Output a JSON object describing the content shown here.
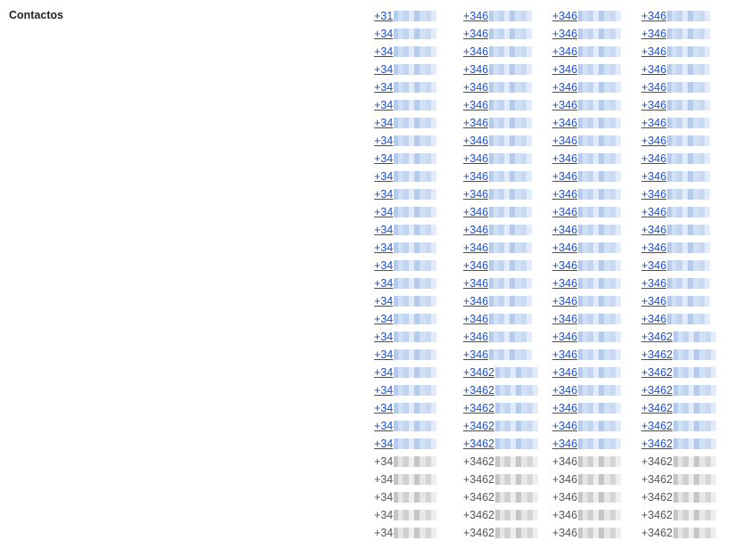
{
  "section": {
    "title": "Contactos"
  },
  "contacts": {
    "rows": [
      {
        "linked": true,
        "cols": [
          "+31",
          "+346",
          "+346",
          "+346"
        ]
      },
      {
        "linked": true,
        "cols": [
          "+34",
          "+346",
          "+346",
          "+346"
        ]
      },
      {
        "linked": true,
        "cols": [
          "+34",
          "+346",
          "+346",
          "+346"
        ]
      },
      {
        "linked": true,
        "cols": [
          "+34",
          "+346",
          "+346",
          "+346"
        ]
      },
      {
        "linked": true,
        "cols": [
          "+34",
          "+346",
          "+346",
          "+346"
        ]
      },
      {
        "linked": true,
        "cols": [
          "+34",
          "+346",
          "+346",
          "+346"
        ]
      },
      {
        "linked": true,
        "cols": [
          "+34",
          "+346",
          "+346",
          "+346"
        ]
      },
      {
        "linked": true,
        "cols": [
          "+34",
          "+346",
          "+346",
          "+346"
        ]
      },
      {
        "linked": true,
        "cols": [
          "+34",
          "+346",
          "+346",
          "+346"
        ]
      },
      {
        "linked": true,
        "cols": [
          "+34",
          "+346",
          "+346",
          "+346"
        ]
      },
      {
        "linked": true,
        "cols": [
          "+34",
          "+346",
          "+346",
          "+346"
        ]
      },
      {
        "linked": true,
        "cols": [
          "+34",
          "+346",
          "+346",
          "+346"
        ]
      },
      {
        "linked": true,
        "cols": [
          "+34",
          "+346",
          "+346",
          "+346"
        ]
      },
      {
        "linked": true,
        "cols": [
          "+34",
          "+346",
          "+346",
          "+346"
        ]
      },
      {
        "linked": true,
        "cols": [
          "+34",
          "+346",
          "+346",
          "+346"
        ]
      },
      {
        "linked": true,
        "cols": [
          "+34",
          "+346",
          "+346",
          "+346"
        ]
      },
      {
        "linked": true,
        "cols": [
          "+34",
          "+346",
          "+346",
          "+346"
        ]
      },
      {
        "linked": true,
        "cols": [
          "+34",
          "+346",
          "+346",
          "+346"
        ]
      },
      {
        "linked": true,
        "cols": [
          "+34",
          "+346",
          "+346",
          "+3462"
        ]
      },
      {
        "linked": true,
        "cols": [
          "+34",
          "+346",
          "+346",
          "+3462"
        ]
      },
      {
        "linked": true,
        "cols": [
          "+34",
          "+3462",
          "+346",
          "+3462"
        ]
      },
      {
        "linked": true,
        "cols": [
          "+34",
          "+3462",
          "+346",
          "+3462"
        ]
      },
      {
        "linked": true,
        "cols": [
          "+34",
          "+3462",
          "+346",
          "+3462"
        ]
      },
      {
        "linked": true,
        "cols": [
          "+34",
          "+3462",
          "+346",
          "+3462"
        ]
      },
      {
        "linked": true,
        "cols": [
          "+34",
          "+3462",
          "+346",
          "+3462"
        ]
      },
      {
        "linked": false,
        "cols": [
          "+34",
          "+3462",
          "+346",
          "+3462"
        ]
      },
      {
        "linked": false,
        "cols": [
          "+34",
          "+3462",
          "+346",
          "+3462"
        ]
      },
      {
        "linked": false,
        "cols": [
          "+34",
          "+3462",
          "+346",
          "+3462"
        ]
      },
      {
        "linked": false,
        "cols": [
          "+34",
          "+3462",
          "+346",
          "+3462"
        ]
      },
      {
        "linked": false,
        "cols": [
          "+34",
          "+3462",
          "+346",
          "+3462"
        ]
      }
    ]
  }
}
